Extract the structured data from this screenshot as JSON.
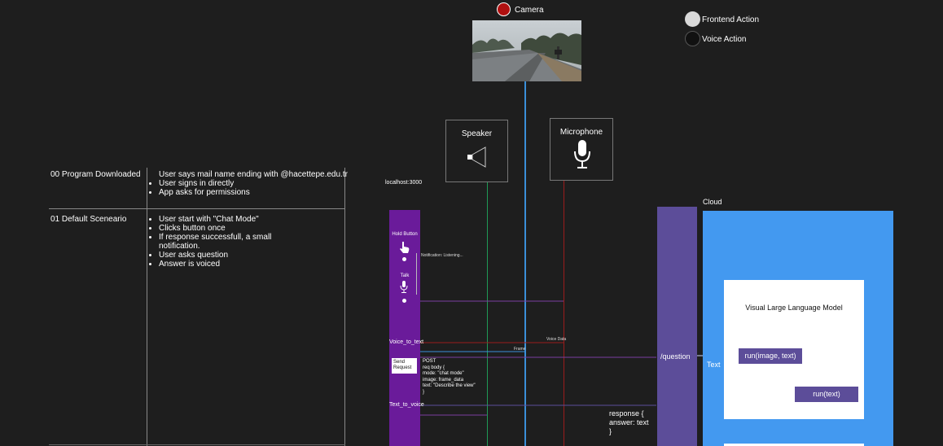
{
  "colors": {
    "background": "#1e1e1e",
    "purple": "#6a1b9a",
    "lavender": "#5c4d99",
    "cloud_blue": "#4399f0",
    "camera_line": "#3a8fd8",
    "speaker_line": "#1f9a55",
    "mic_line": "#9b1c1c",
    "camera_dot": "#b01010"
  },
  "legend": {
    "frontend": "Frontend Action",
    "voice": "Voice Action"
  },
  "devices": {
    "camera": "Camera",
    "speaker": "Speaker",
    "microphone": "Microphone"
  },
  "scenarios": [
    {
      "title": "00 Program Downloaded",
      "steps": [
        "User says mail name ending with @hacettepe.edu.tr",
        "User signs in directly",
        "App asks for permissions"
      ]
    },
    {
      "title": "01 Default Sceneario",
      "steps": [
        "User start with \"Chat Mode\"",
        "Clicks button once",
        "If response successfull, a small notification.",
        "User asks question",
        "Answer is voiced"
      ]
    }
  ],
  "app": {
    "host": "localhost:3000",
    "hold_button": "Hold Button",
    "talk": "Talk",
    "voice_to_text": "Voice_to_text",
    "send_request": "Send Request",
    "text_to_voice": "Text_to_voice"
  },
  "messages": {
    "notification": "Notification: Listening...",
    "voice_data": "Voice Data",
    "frame": "Frame",
    "post_lines": [
      "POST",
      "req body {",
      "mode: \"chat mode\"",
      "image: frame_data",
      "text: \"Describe the view\"",
      "}"
    ],
    "response_lines": [
      "response {",
      "answer: text",
      "}"
    ]
  },
  "server": {
    "endpoint": "/question",
    "text_label": "Text"
  },
  "cloud": {
    "title": "Cloud",
    "model": "Visual Large Language Model",
    "run_image": "run(image, text)",
    "run_text": "run(text)"
  },
  "icons": {
    "camera": "camera-record-dot",
    "speaker": "speaker-icon",
    "microphone": "microphone-icon",
    "hand": "hand-pointer-icon"
  }
}
